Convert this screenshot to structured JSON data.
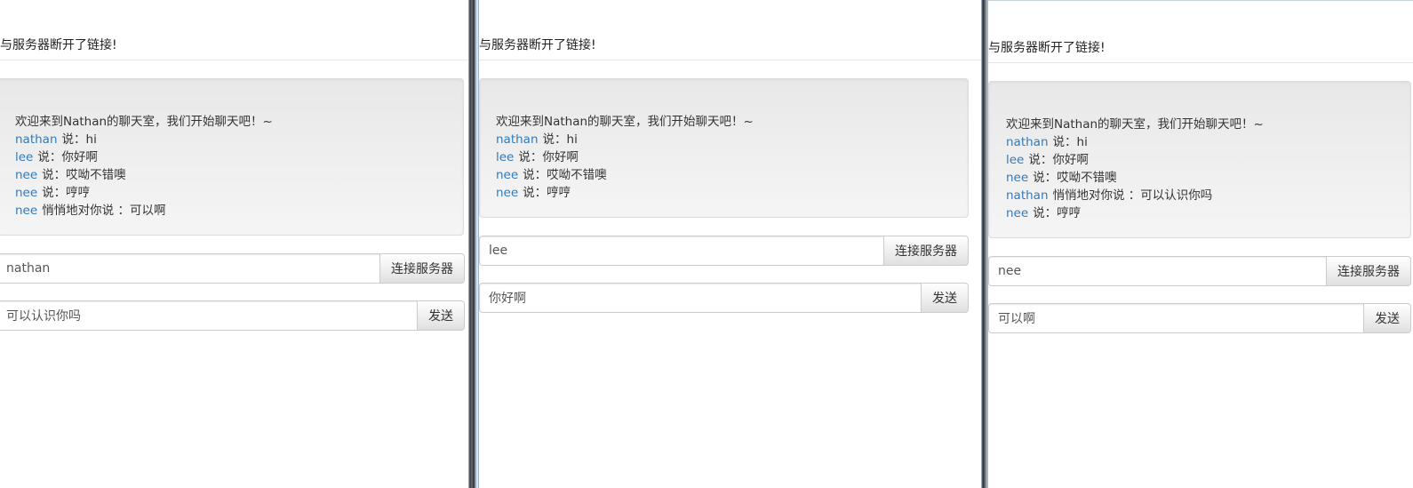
{
  "windows": [
    {
      "status": "与服务器断开了链接!",
      "messages": [
        {
          "text": "欢迎来到Nathan的聊天室，我们开始聊天吧！~"
        },
        {
          "user": "nathan",
          "text": "说：hi"
        },
        {
          "user": "lee",
          "text": "说：你好啊"
        },
        {
          "user": "nee",
          "text": "说：哎呦不错噢"
        },
        {
          "user": "nee",
          "text": "说：哼哼"
        },
        {
          "user": "nee",
          "text": "悄悄地对你说 ：可以啊"
        }
      ],
      "username_value": "nathan",
      "connect_label": "连接服务器",
      "message_value": "可以认识你吗",
      "send_label": "发送"
    },
    {
      "status": "与服务器断开了链接!",
      "messages": [
        {
          "text": "欢迎来到Nathan的聊天室，我们开始聊天吧！~"
        },
        {
          "user": "nathan",
          "text": "说：hi"
        },
        {
          "user": "lee",
          "text": "说：你好啊"
        },
        {
          "user": "nee",
          "text": "说：哎呦不错噢"
        },
        {
          "user": "nee",
          "text": "说：哼哼"
        }
      ],
      "username_value": "lee",
      "connect_label": "连接服务器",
      "message_value": "你好啊",
      "send_label": "发送"
    },
    {
      "status": "与服务器断开了链接!",
      "messages": [
        {
          "text": "欢迎来到Nathan的聊天室，我们开始聊天吧！~"
        },
        {
          "user": "nathan",
          "text": "说：hi"
        },
        {
          "user": "lee",
          "text": "说：你好啊"
        },
        {
          "user": "nee",
          "text": "说：哎呦不错噢"
        },
        {
          "user": "nathan",
          "text": "悄悄地对你说 ：可以认识你吗"
        },
        {
          "user": "nee",
          "text": "说：哼哼"
        }
      ],
      "username_value": "nee",
      "connect_label": "连接服务器",
      "message_value": "可以啊",
      "send_label": "发送"
    }
  ]
}
